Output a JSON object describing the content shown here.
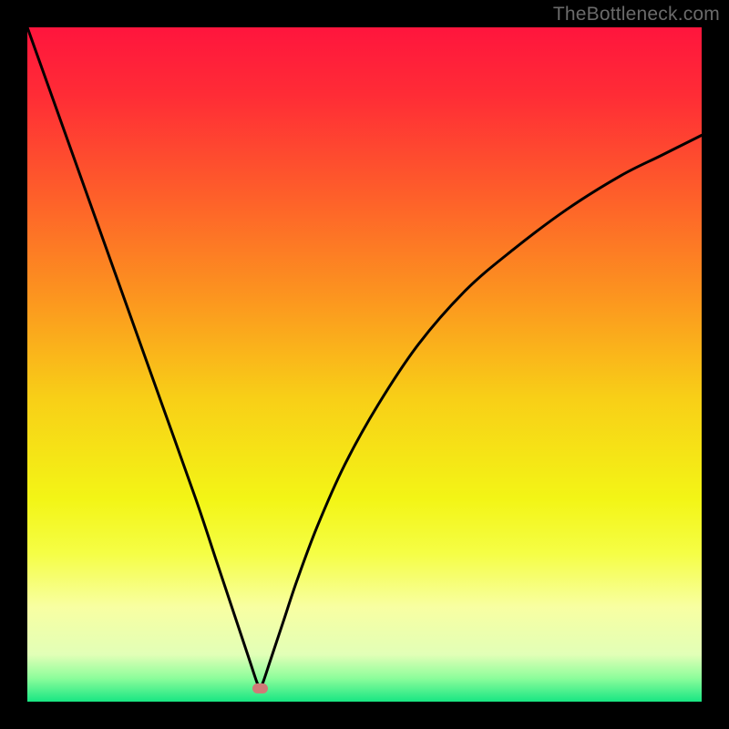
{
  "watermark": {
    "text": "TheBottleneck.com"
  },
  "colors": {
    "frame": "#000000",
    "curve_stroke": "#000000",
    "marker": "#cf7a77",
    "watermark": "#6a6a6a",
    "gradient_stops": [
      {
        "offset": 0.0,
        "color": "#ff153d"
      },
      {
        "offset": 0.1,
        "color": "#ff2c36"
      },
      {
        "offset": 0.25,
        "color": "#fe5f2a"
      },
      {
        "offset": 0.4,
        "color": "#fc951f"
      },
      {
        "offset": 0.55,
        "color": "#f8cf17"
      },
      {
        "offset": 0.7,
        "color": "#f3f516"
      },
      {
        "offset": 0.78,
        "color": "#f5fe45"
      },
      {
        "offset": 0.86,
        "color": "#f8ffa2"
      },
      {
        "offset": 0.93,
        "color": "#e2ffb7"
      },
      {
        "offset": 0.965,
        "color": "#8dfd9b"
      },
      {
        "offset": 1.0,
        "color": "#18e683"
      }
    ]
  },
  "chart_data": {
    "type": "line",
    "title": "",
    "xlabel": "",
    "ylabel": "",
    "xlim": [
      0,
      100
    ],
    "ylim": [
      0,
      100
    ],
    "marker": {
      "x": 34.5,
      "y": 2,
      "width_pct": 2.3,
      "height_pct": 1.5
    },
    "curve": [
      {
        "x": 0,
        "y": 100
      },
      {
        "x": 5,
        "y": 86
      },
      {
        "x": 10,
        "y": 72
      },
      {
        "x": 15,
        "y": 58
      },
      {
        "x": 20,
        "y": 44
      },
      {
        "x": 25,
        "y": 30
      },
      {
        "x": 28,
        "y": 21
      },
      {
        "x": 30,
        "y": 15
      },
      {
        "x": 32,
        "y": 9
      },
      {
        "x": 33,
        "y": 6
      },
      {
        "x": 34,
        "y": 3
      },
      {
        "x": 34.5,
        "y": 2
      },
      {
        "x": 35,
        "y": 3
      },
      {
        "x": 36,
        "y": 6
      },
      {
        "x": 37,
        "y": 9
      },
      {
        "x": 38,
        "y": 12
      },
      {
        "x": 40,
        "y": 18
      },
      {
        "x": 43,
        "y": 26
      },
      {
        "x": 47,
        "y": 35
      },
      {
        "x": 52,
        "y": 44
      },
      {
        "x": 58,
        "y": 53
      },
      {
        "x": 65,
        "y": 61
      },
      {
        "x": 72,
        "y": 67
      },
      {
        "x": 80,
        "y": 73
      },
      {
        "x": 88,
        "y": 78
      },
      {
        "x": 94,
        "y": 81
      },
      {
        "x": 100,
        "y": 84
      }
    ]
  }
}
